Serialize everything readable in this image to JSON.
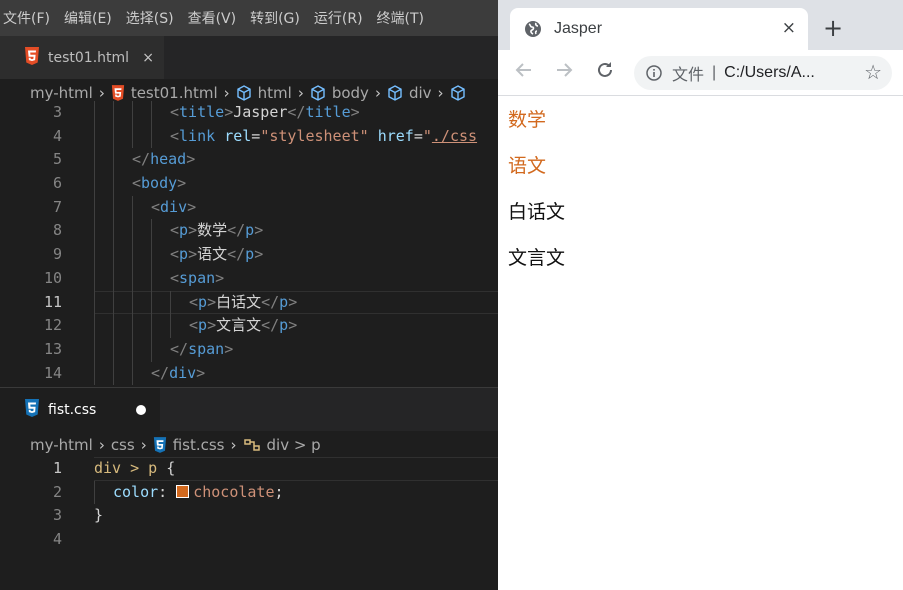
{
  "menubar": [
    "文件(F)",
    "编辑(E)",
    "选择(S)",
    "查看(V)",
    "转到(G)",
    "运行(R)",
    "终端(T)"
  ],
  "editor_top": {
    "tab": {
      "label": "test01.html",
      "close": "×"
    },
    "breadcrumb": [
      "my-html",
      "test01.html",
      "html",
      "body",
      "div"
    ],
    "lines": [
      {
        "n": "3",
        "tokens": [
          [
            "p",
            "<"
          ],
          [
            "tag",
            "title"
          ],
          [
            "p",
            ">"
          ],
          [
            "txt",
            "Jasper"
          ],
          [
            "p",
            "</"
          ],
          [
            "tag",
            "title"
          ],
          [
            "p",
            ">"
          ]
        ],
        "indent": 4
      },
      {
        "n": "4",
        "tokens": [
          [
            "p",
            "<"
          ],
          [
            "tag",
            "link"
          ],
          [
            "txt",
            " "
          ],
          [
            "attr",
            "rel"
          ],
          [
            "txt",
            "="
          ],
          [
            "str",
            "\"stylesheet\""
          ],
          [
            "txt",
            " "
          ],
          [
            "attr",
            "href"
          ],
          [
            "txt",
            "="
          ],
          [
            "str",
            "\""
          ],
          [
            "link",
            "./css"
          ]
        ],
        "indent": 4
      },
      {
        "n": "5",
        "tokens": [
          [
            "p",
            "</"
          ],
          [
            "tag",
            "head"
          ],
          [
            "p",
            ">"
          ]
        ],
        "indent": 2
      },
      {
        "n": "6",
        "tokens": [
          [
            "p",
            "<"
          ],
          [
            "tag",
            "body"
          ],
          [
            "p",
            ">"
          ]
        ],
        "indent": 2
      },
      {
        "n": "7",
        "tokens": [
          [
            "p",
            "<"
          ],
          [
            "tag",
            "div"
          ],
          [
            "p",
            ">"
          ]
        ],
        "indent": 3
      },
      {
        "n": "8",
        "tokens": [
          [
            "p",
            "<"
          ],
          [
            "tag",
            "p"
          ],
          [
            "p",
            ">"
          ],
          [
            "txt",
            "数学"
          ],
          [
            "p",
            "</"
          ],
          [
            "tag",
            "p"
          ],
          [
            "p",
            ">"
          ]
        ],
        "indent": 4
      },
      {
        "n": "9",
        "tokens": [
          [
            "p",
            "<"
          ],
          [
            "tag",
            "p"
          ],
          [
            "p",
            ">"
          ],
          [
            "txt",
            "语文"
          ],
          [
            "p",
            "</"
          ],
          [
            "tag",
            "p"
          ],
          [
            "p",
            ">"
          ]
        ],
        "indent": 4
      },
      {
        "n": "10",
        "tokens": [
          [
            "p",
            "<"
          ],
          [
            "tag",
            "span"
          ],
          [
            "p",
            ">"
          ]
        ],
        "indent": 4
      },
      {
        "n": "11",
        "tokens": [
          [
            "p",
            "<"
          ],
          [
            "tag",
            "p"
          ],
          [
            "p",
            ">"
          ],
          [
            "txt",
            "白话文"
          ],
          [
            "p",
            "</"
          ],
          [
            "tag",
            "p"
          ],
          [
            "p",
            ">"
          ]
        ],
        "indent": 5,
        "current": true
      },
      {
        "n": "12",
        "tokens": [
          [
            "p",
            "<"
          ],
          [
            "tag",
            "p"
          ],
          [
            "p",
            ">"
          ],
          [
            "txt",
            "文言文"
          ],
          [
            "p",
            "</"
          ],
          [
            "tag",
            "p"
          ],
          [
            "p",
            ">"
          ]
        ],
        "indent": 5
      },
      {
        "n": "13",
        "tokens": [
          [
            "p",
            "</"
          ],
          [
            "tag",
            "span"
          ],
          [
            "p",
            ">"
          ]
        ],
        "indent": 4
      },
      {
        "n": "14",
        "tokens": [
          [
            "p",
            "</"
          ],
          [
            "tag",
            "div"
          ],
          [
            "p",
            ">"
          ]
        ],
        "indent": 3
      }
    ]
  },
  "editor_bottom": {
    "tab": {
      "label": "fist.css"
    },
    "breadcrumb": [
      "my-html",
      "css",
      "fist.css",
      "div > p"
    ],
    "lines": [
      {
        "n": "1",
        "tokens": [
          [
            "sel",
            "div > p "
          ],
          [
            "txt",
            "{"
          ]
        ],
        "indent": 0,
        "current": true
      },
      {
        "n": "2",
        "tokens": [
          [
            "prop",
            "color"
          ],
          [
            "txt",
            ": "
          ],
          [
            "swatch",
            ""
          ],
          [
            "val",
            "chocolate"
          ],
          [
            "txt",
            ";"
          ]
        ],
        "indent": 1
      },
      {
        "n": "3",
        "tokens": [
          [
            "txt",
            "}"
          ]
        ],
        "indent": 0
      },
      {
        "n": "4",
        "tokens": [],
        "indent": 0
      }
    ]
  },
  "browser": {
    "tab_title": "Jasper",
    "tab_close": "×",
    "new_tab": "+",
    "url_scheme": "文件",
    "url_divider": "|",
    "url": "C:/Users/A...",
    "page_items": [
      {
        "text": "数学",
        "color": "#d2691e"
      },
      {
        "text": "语文",
        "color": "#d2691e"
      },
      {
        "text": "白话文",
        "color": "#111111"
      },
      {
        "text": "文言文",
        "color": "#111111"
      }
    ]
  }
}
